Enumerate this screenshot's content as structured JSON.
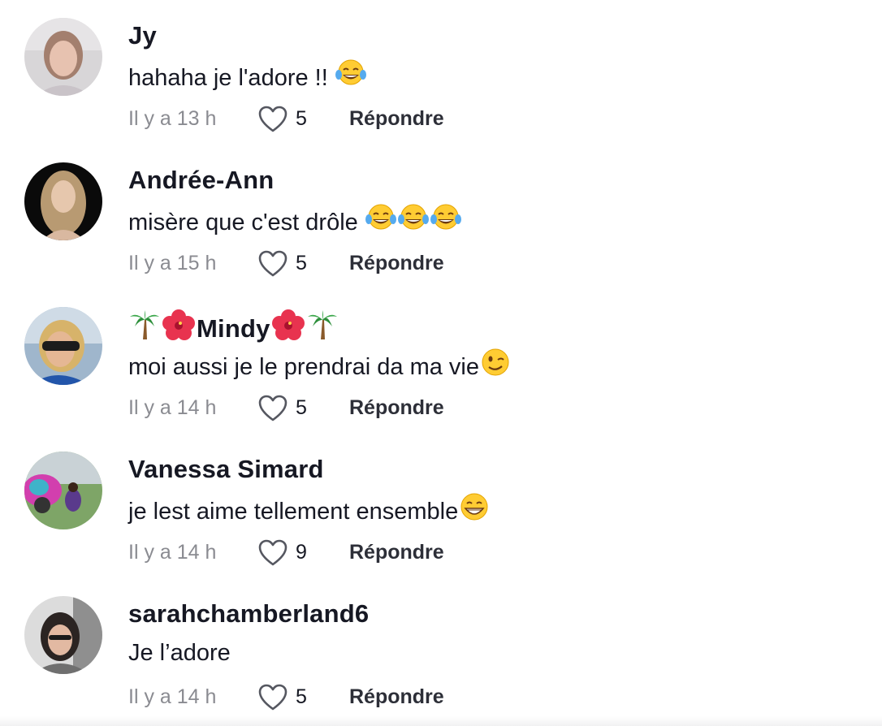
{
  "comments": [
    {
      "username": "Jy",
      "text": "hahaha je l'adore !! ",
      "time": "Il y a 13 h",
      "likes": "5",
      "reply": "Répondre",
      "emojis": [
        "joy"
      ]
    },
    {
      "username": "Andrée-Ann",
      "text": "misère que c'est drôle ",
      "time": "Il y a 15 h",
      "likes": "5",
      "reply": "Répondre",
      "emojis": [
        "joy",
        "joy",
        "joy"
      ]
    },
    {
      "username": "Mindy",
      "username_decoration": [
        "palm-tree",
        "hibiscus",
        "hibiscus",
        "palm-tree"
      ],
      "text": "moi aussi je le prendrai da ma vie",
      "time": "Il y a 14 h",
      "likes": "5",
      "reply": "Répondre",
      "emojis": [
        "wink"
      ]
    },
    {
      "username": "Vanessa Simard",
      "text": "je lest aime tellement ensemble",
      "time": "Il y a 14 h",
      "likes": "9",
      "reply": "Répondre",
      "emojis": [
        "grin"
      ]
    },
    {
      "username": "sarahchamberland6",
      "text": "Je l’adore",
      "time": "Il y a 14 h",
      "likes": "5",
      "reply": "Répondre",
      "emojis": []
    }
  ],
  "colors": {
    "text": "#161823",
    "muted": "#8a8b91",
    "reply": "#2d2f38",
    "emoji_face": "#FFCC33"
  }
}
